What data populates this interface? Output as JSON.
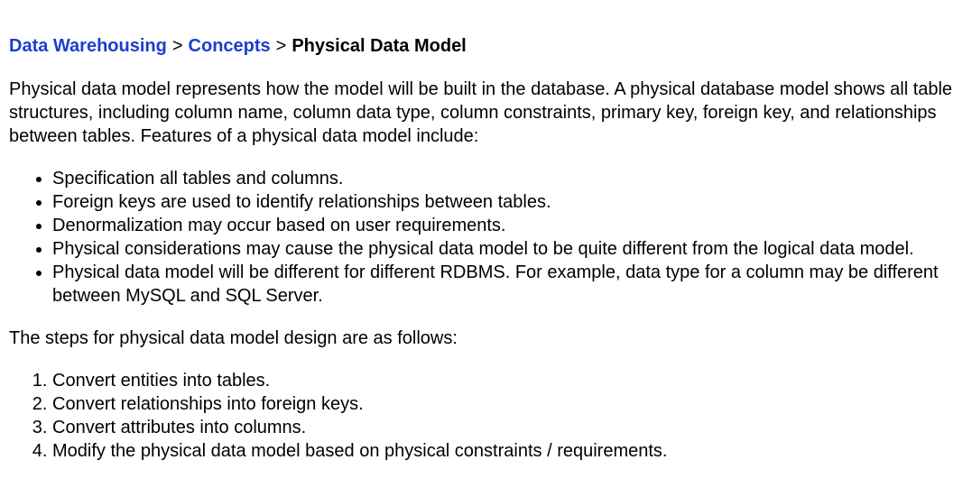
{
  "breadcrumb": {
    "items": [
      {
        "label": "Data Warehousing",
        "link": true
      },
      {
        "label": "Concepts",
        "link": true
      },
      {
        "label": "Physical Data Model",
        "link": false
      }
    ],
    "separator": ">"
  },
  "intro": "Physical data model represents how the model will be built in the database. A physical database model shows all table structures, including column name, column data type, column constraints, primary key, foreign key, and relationships between tables. Features of a physical data model include:",
  "features": [
    "Specification all tables and columns.",
    "Foreign keys are used to identify relationships between tables.",
    "Denormalization may occur based on user requirements.",
    "Physical considerations may cause the physical data model to be quite different from the logical data model.",
    "Physical data model will be different for different RDBMS. For example, data type for a column may be different between MySQL and SQL Server."
  ],
  "steps_intro": "The steps for physical data model design are as follows:",
  "steps": [
    "Convert entities into tables.",
    "Convert relationships into foreign keys.",
    "Convert attributes into columns.",
    "Modify the physical data model based on physical constraints / requirements."
  ],
  "colors": {
    "link": "#1a3fcc",
    "text": "#000000",
    "background": "#ffffff"
  }
}
